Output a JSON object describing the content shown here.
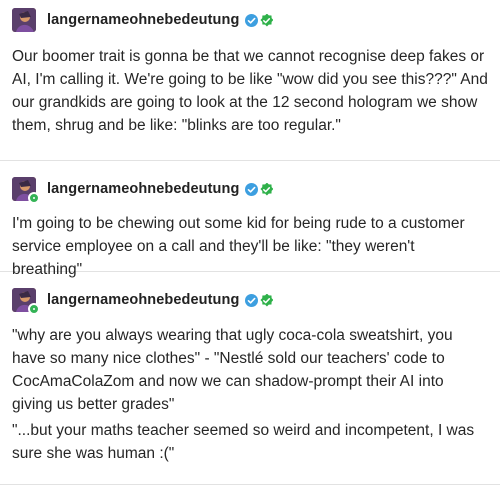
{
  "posts": [
    {
      "username": "langernameohnebedeutung",
      "paragraphs": [
        "Our boomer trait is gonna be that we cannot recognise deep fakes or AI, I'm calling it. We're going to be like \"wow did you see this???\" And our grandkids are going to look at the 12 second hologram we show them, shrug and be like: \"blinks are too regular.\""
      ]
    },
    {
      "username": "langernameohnebedeutung",
      "paragraphs": [
        "I'm going to be chewing out some kid for being rude to a customer service employee on a call and they'll be like: \"they weren't breathing\""
      ]
    },
    {
      "username": "langernameohnebedeutung",
      "paragraphs": [
        "\"why are you always wearing that ugly coca-cola sweatshirt, you have so many nice clothes\" - \"Nestlé sold our teachers' code to CocAmaColaZom and now we can shadow-prompt their AI into giving us better grades\"",
        "\"...but your maths teacher seemed so weird and incompetent, I was sure she was human :(\""
      ]
    }
  ],
  "colors": {
    "text": "#262626",
    "divider": "#e2e2e2",
    "verified_blue": "#3d9fe0",
    "badge_green": "#2fb14a"
  },
  "icons": {
    "verified": "blue-checkmark-badge",
    "green_badge": "green-star-badge",
    "avatar": "user-avatar"
  }
}
